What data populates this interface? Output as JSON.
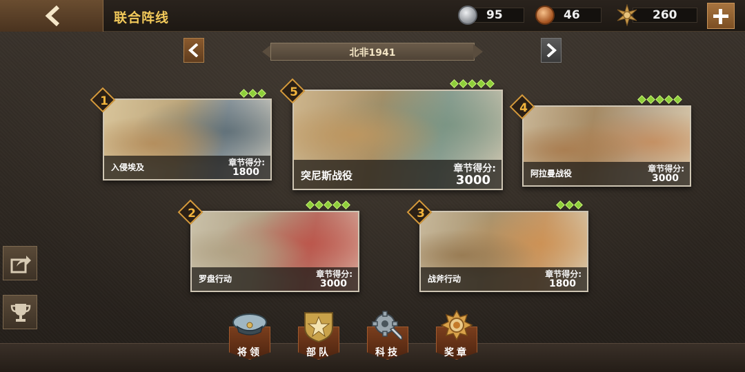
{
  "header": {
    "title": "联合阵线",
    "resources": [
      {
        "name": "silver-medal",
        "value": "95",
        "color": "#b8bcc2"
      },
      {
        "name": "bronze-medal",
        "value": "46",
        "color": "#c8743a"
      },
      {
        "name": "gold-star-emblem",
        "value": "260",
        "color": "#c99a4a"
      }
    ]
  },
  "region": {
    "label": "北非1941"
  },
  "chapters": [
    {
      "number": "1",
      "name": "入侵埃及",
      "score_label": "章节得分:",
      "score": "1800",
      "stars": 3
    },
    {
      "number": "5",
      "name": "突尼斯战役",
      "score_label": "章节得分:",
      "score": "3000",
      "stars": 5
    },
    {
      "number": "4",
      "name": "阿拉曼战役",
      "score_label": "章节得分:",
      "score": "3000",
      "stars": 5
    },
    {
      "number": "2",
      "name": "罗盘行动",
      "score_label": "章节得分:",
      "score": "3000",
      "stars": 5
    },
    {
      "number": "3",
      "name": "战斧行动",
      "score_label": "章节得分:",
      "score": "1800",
      "stars": 3
    }
  ],
  "nav": [
    {
      "label": "将领",
      "icon": "officer-cap-icon"
    },
    {
      "label": "部队",
      "icon": "army-star-badge-icon"
    },
    {
      "label": "科技",
      "icon": "gear-wrench-icon"
    },
    {
      "label": "奖章",
      "icon": "medal-icon"
    }
  ],
  "side": [
    {
      "icon": "share-icon"
    },
    {
      "icon": "trophy-icon"
    }
  ],
  "colors": {
    "accent": "#f2c95a",
    "star": "#8ecf3a",
    "badge_border": "#d59a3c"
  }
}
